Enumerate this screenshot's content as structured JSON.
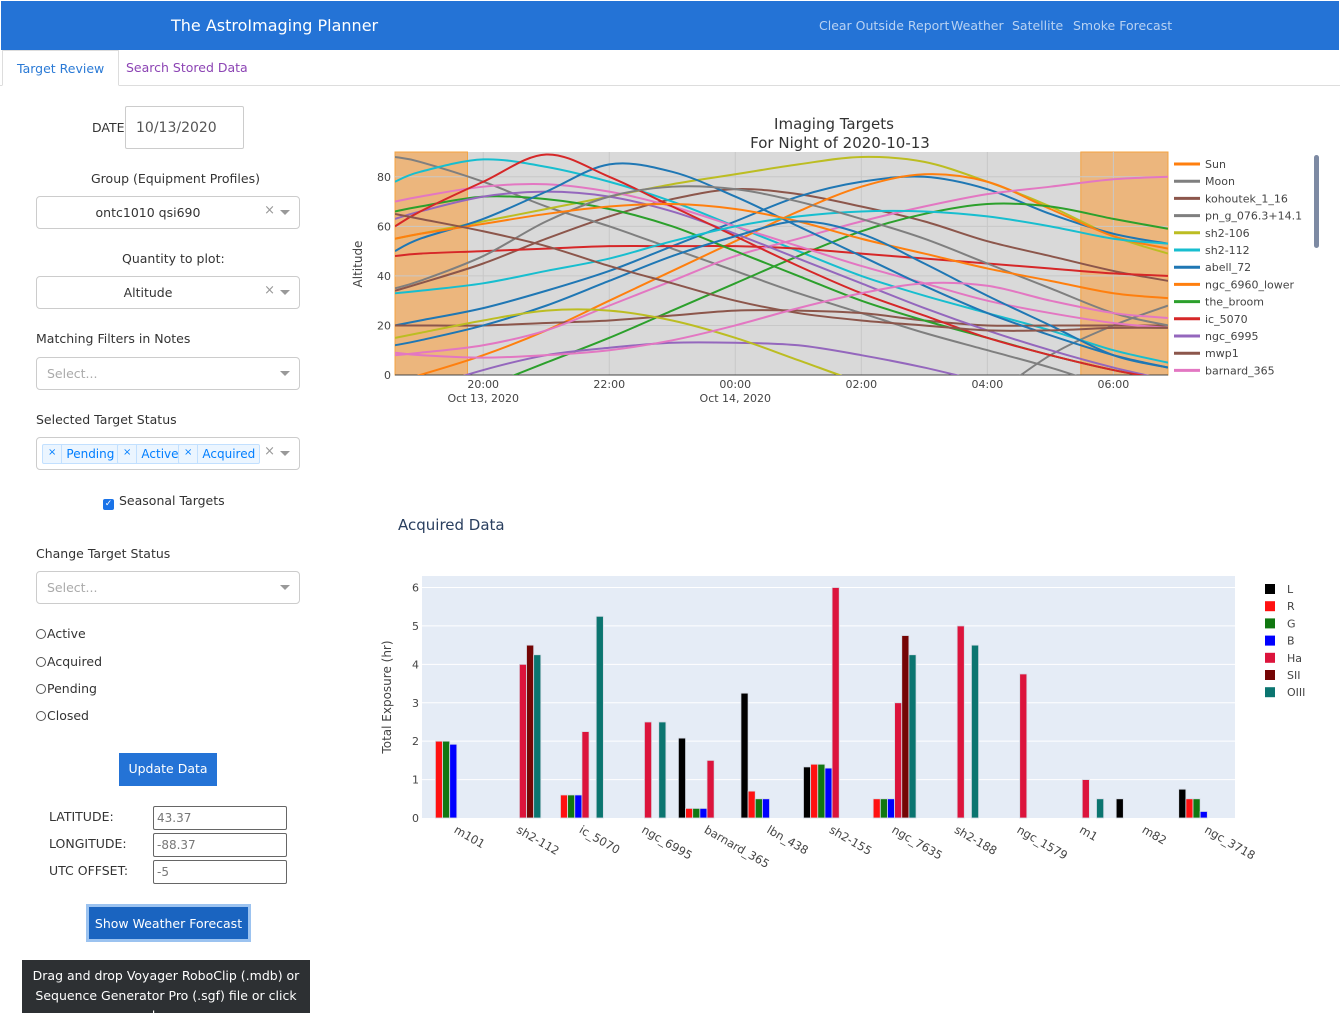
{
  "header": {
    "title": "The AstroImaging Planner",
    "nav": [
      "Clear Outside Report",
      "Weather",
      "Satellite",
      "Smoke Forecast"
    ]
  },
  "tabs": [
    "Target Review",
    "Search Stored Data"
  ],
  "sidebar": {
    "date_label": "DATE:",
    "date_value": "10/13/2020",
    "group_label": "Group (Equipment Profiles)",
    "group_value": "ontc1010 qsi690",
    "quantity_label": "Quantity to plot:",
    "quantity_value": "Altitude",
    "filters_label": "Matching Filters in Notes",
    "filters_placeholder": "Select...",
    "status_label": "Selected Target Status",
    "status_chips": [
      "Pending",
      "Active",
      "Acquired"
    ],
    "seasonal_label": "Seasonal Targets",
    "seasonal_checked": true,
    "change_label": "Change Target Status",
    "change_placeholder": "Select...",
    "radios": [
      "Active",
      "Acquired",
      "Pending",
      "Closed"
    ],
    "update_button": "Update Data",
    "lat_label": "LATITUDE:",
    "lat_value": "43.37",
    "lon_label": "LONGITUDE:",
    "lon_value": "-88.37",
    "utc_label": "UTC OFFSET:",
    "utc_value": "-5",
    "weather_button": "Show Weather Forecast",
    "upload_line1": "Drag and drop Voyager RoboClip (.mdb) or",
    "upload_line2": "Sequence Generator Pro (.sgf) file or click here"
  },
  "acquired_title": "Acquired Data",
  "chart_data": [
    {
      "type": "line",
      "title": "Imaging Targets",
      "subtitle": "For Night of 2020-10-13",
      "ylabel": "Altitude",
      "ylim": [
        0,
        90
      ],
      "xlim": [
        "18:36",
        "06:52"
      ],
      "yticks": [
        0,
        20,
        40,
        60,
        80
      ],
      "xticks": [
        {
          "t": "20:00",
          "l1": "20:00",
          "l2": "Oct 13, 2020"
        },
        {
          "t": "22:00",
          "l1": "22:00",
          "l2": ""
        },
        {
          "t": "00:00",
          "l1": "00:00",
          "l2": "Oct 14, 2020"
        },
        {
          "t": "02:00",
          "l1": "02:00",
          "l2": ""
        },
        {
          "t": "04:00",
          "l1": "04:00",
          "l2": ""
        },
        {
          "t": "06:00",
          "l1": "06:00",
          "l2": ""
        }
      ],
      "twilight_shading": [
        [
          "18:36",
          "19:45"
        ],
        [
          "05:29",
          "06:52"
        ]
      ],
      "shading_color": "#ecb67d",
      "x": [
        "18:36",
        "19:00",
        "20:00",
        "21:00",
        "22:00",
        "23:00",
        "00:00",
        "01:00",
        "02:00",
        "03:00",
        "04:00",
        "05:00",
        "06:00",
        "06:52"
      ],
      "series": [
        {
          "name": "Sun",
          "color": "#ff7f0e",
          "values": []
        },
        {
          "name": "Moon",
          "color": "#7f7f7f",
          "values": [
            null,
            null,
            null,
            null,
            null,
            null,
            null,
            null,
            null,
            null,
            -10,
            8,
            20,
            28
          ]
        },
        {
          "name": "kohoutek_1_16",
          "color": "#8c564b",
          "values": [
            34,
            37,
            45,
            55,
            64,
            71,
            75,
            73,
            68,
            62,
            54,
            48,
            42,
            38
          ]
        },
        {
          "name": "pn_g_076.3+14.1",
          "color": "#7f7f7f",
          "values": [
            88,
            86,
            78,
            68,
            60,
            51,
            42,
            33,
            25,
            17,
            10,
            3,
            -5,
            -10
          ]
        },
        {
          "name": "sh2-106",
          "color": "#bcbd22",
          "values": [
            55,
            57,
            62,
            67,
            72,
            77,
            81,
            85,
            88,
            86,
            78,
            68,
            56,
            49
          ]
        },
        {
          "name": "sh2-112",
          "color": "#17becf",
          "values": [
            78,
            82,
            87,
            84,
            78,
            70,
            60,
            50,
            40,
            32,
            25,
            18,
            10,
            5
          ]
        },
        {
          "name": "abell_72",
          "color": "#1f77b4",
          "values": [
            20,
            22,
            27,
            34,
            42,
            52,
            62,
            72,
            78,
            80,
            75,
            65,
            57,
            53
          ]
        },
        {
          "name": "ngc_6960_lower",
          "color": "#ff7f0e",
          "values": [
            -3,
            0,
            8,
            18,
            30,
            42,
            54,
            66,
            76,
            81,
            78,
            67,
            56,
            51
          ]
        },
        {
          "name": "the_broom",
          "color": "#2ca02c",
          "values": [
            -20,
            -15,
            -5,
            5,
            15,
            26,
            37,
            48,
            58,
            65,
            69,
            68,
            63,
            59
          ]
        },
        {
          "name": "ic_5070",
          "color": "#d62728",
          "values": [
            48,
            49,
            50,
            51,
            52,
            52,
            52,
            51,
            49,
            47,
            45,
            43,
            41,
            40
          ]
        },
        {
          "name": "ngc_6995",
          "color": "#9467bd",
          "values": [
            -10,
            -6,
            2,
            8,
            11,
            13,
            13,
            12,
            8,
            3,
            -3,
            -8,
            -12,
            -15
          ]
        },
        {
          "name": "mwp1",
          "color": "#8c564b",
          "values": [
            20,
            20,
            20,
            21,
            22,
            24,
            26,
            26,
            25,
            22,
            20,
            20,
            20,
            20
          ]
        },
        {
          "name": "barnard_365",
          "color": "#e377c2",
          "values": [
            8,
            9,
            12,
            18,
            28,
            38,
            48,
            55,
            62,
            68,
            73,
            76,
            79,
            80
          ]
        },
        {
          "color": "#e377c2",
          "values": [
            70,
            72,
            76,
            77,
            74,
            68,
            60,
            52,
            44,
            37,
            30,
            25,
            21,
            19
          ]
        },
        {
          "color": "#2ca02c",
          "values": [
            66,
            68,
            72,
            71,
            67,
            60,
            50,
            40,
            30,
            22,
            15,
            8,
            2,
            -2
          ]
        },
        {
          "color": "#9467bd",
          "values": [
            63,
            66,
            72,
            74,
            72,
            66,
            57,
            47,
            37,
            27,
            18,
            10,
            3,
            -2
          ]
        },
        {
          "color": "#1f77b4",
          "values": [
            50,
            55,
            63,
            74,
            85,
            82,
            72,
            60,
            48,
            36,
            25,
            16,
            8,
            3
          ]
        },
        {
          "color": "#d62728",
          "values": [
            60,
            66,
            78,
            89,
            80,
            68,
            56,
            44,
            33,
            24,
            15,
            8,
            2,
            -2
          ]
        },
        {
          "color": "#17becf",
          "values": [
            33,
            34,
            37,
            42,
            47,
            54,
            60,
            64,
            66,
            66,
            64,
            60,
            55,
            53
          ]
        },
        {
          "color": "#7f7f7f",
          "values": [
            35,
            38,
            48,
            62,
            72,
            76,
            75,
            70,
            63,
            55,
            45,
            35,
            25,
            20
          ]
        },
        {
          "color": "#ff7f0e",
          "values": [
            55,
            57,
            61,
            65,
            68,
            69,
            67,
            62,
            55,
            49,
            43,
            38,
            33,
            31
          ]
        },
        {
          "color": "#1f77b4",
          "values": [
            12,
            14,
            20,
            28,
            38,
            48,
            56,
            62,
            57,
            45,
            32,
            20,
            8,
            3
          ]
        },
        {
          "color": "#bcbd22",
          "values": [
            15,
            17,
            22,
            26,
            26,
            22,
            15,
            6,
            -3,
            -10,
            -15,
            -18,
            -20,
            -20
          ]
        },
        {
          "color": "#8c564b",
          "values": [
            65,
            63,
            58,
            52,
            44,
            37,
            30,
            25,
            22,
            20,
            18,
            18,
            19,
            19
          ]
        },
        {
          "color": "#e377c2",
          "values": [
            9,
            8,
            7,
            8,
            10,
            14,
            20,
            27,
            33,
            37,
            36,
            30,
            25,
            23
          ]
        }
      ]
    },
    {
      "type": "bar",
      "title": "",
      "ylabel": "Total Exposure (hr)",
      "ylim": [
        0,
        6.3
      ],
      "yticks": [
        0,
        1,
        2,
        3,
        4,
        5,
        6
      ],
      "legend": "right",
      "categories": [
        "m101",
        "sh2-112",
        "ic_5070",
        "ngc_6995",
        "barnard_365",
        "lbn_438",
        "sh2-155",
        "ngc_7635",
        "sh2-188",
        "ngc_1579",
        "m1",
        "m82",
        "ngc_3718"
      ],
      "series": [
        {
          "name": "L",
          "color": "#000000",
          "values": [
            0,
            0,
            0,
            0,
            2.08,
            3.25,
            1.33,
            0,
            0,
            0,
            0,
            0.5,
            0.75
          ]
        },
        {
          "name": "R",
          "color": "#ff1111",
          "values": [
            2,
            0,
            0.6,
            0,
            0.25,
            0.7,
            1.4,
            0.5,
            0,
            0,
            0,
            0,
            0.5
          ]
        },
        {
          "name": "G",
          "color": "#117711",
          "values": [
            2,
            0,
            0.6,
            0,
            0.25,
            0.5,
            1.4,
            0.5,
            0,
            0,
            0,
            0,
            0.5
          ]
        },
        {
          "name": "B",
          "color": "#0000ff",
          "values": [
            1.92,
            0,
            0.6,
            0,
            0.25,
            0.5,
            1.3,
            0.5,
            0,
            0,
            0,
            0,
            0.17
          ]
        },
        {
          "name": "Ha",
          "color": "#dc143c",
          "values": [
            0,
            4,
            2.25,
            2.5,
            1.5,
            0,
            6,
            3,
            5,
            3.75,
            1,
            0,
            0
          ]
        },
        {
          "name": "SII",
          "color": "#750505",
          "values": [
            0,
            4.5,
            0,
            0,
            0,
            0,
            0,
            4.75,
            0,
            0,
            0,
            0,
            0
          ]
        },
        {
          "name": "OIII",
          "color": "#0b7570",
          "values": [
            0,
            4.25,
            5.25,
            2.5,
            0,
            0,
            0,
            4.25,
            4.5,
            0,
            0.5,
            0,
            0
          ]
        }
      ]
    }
  ]
}
